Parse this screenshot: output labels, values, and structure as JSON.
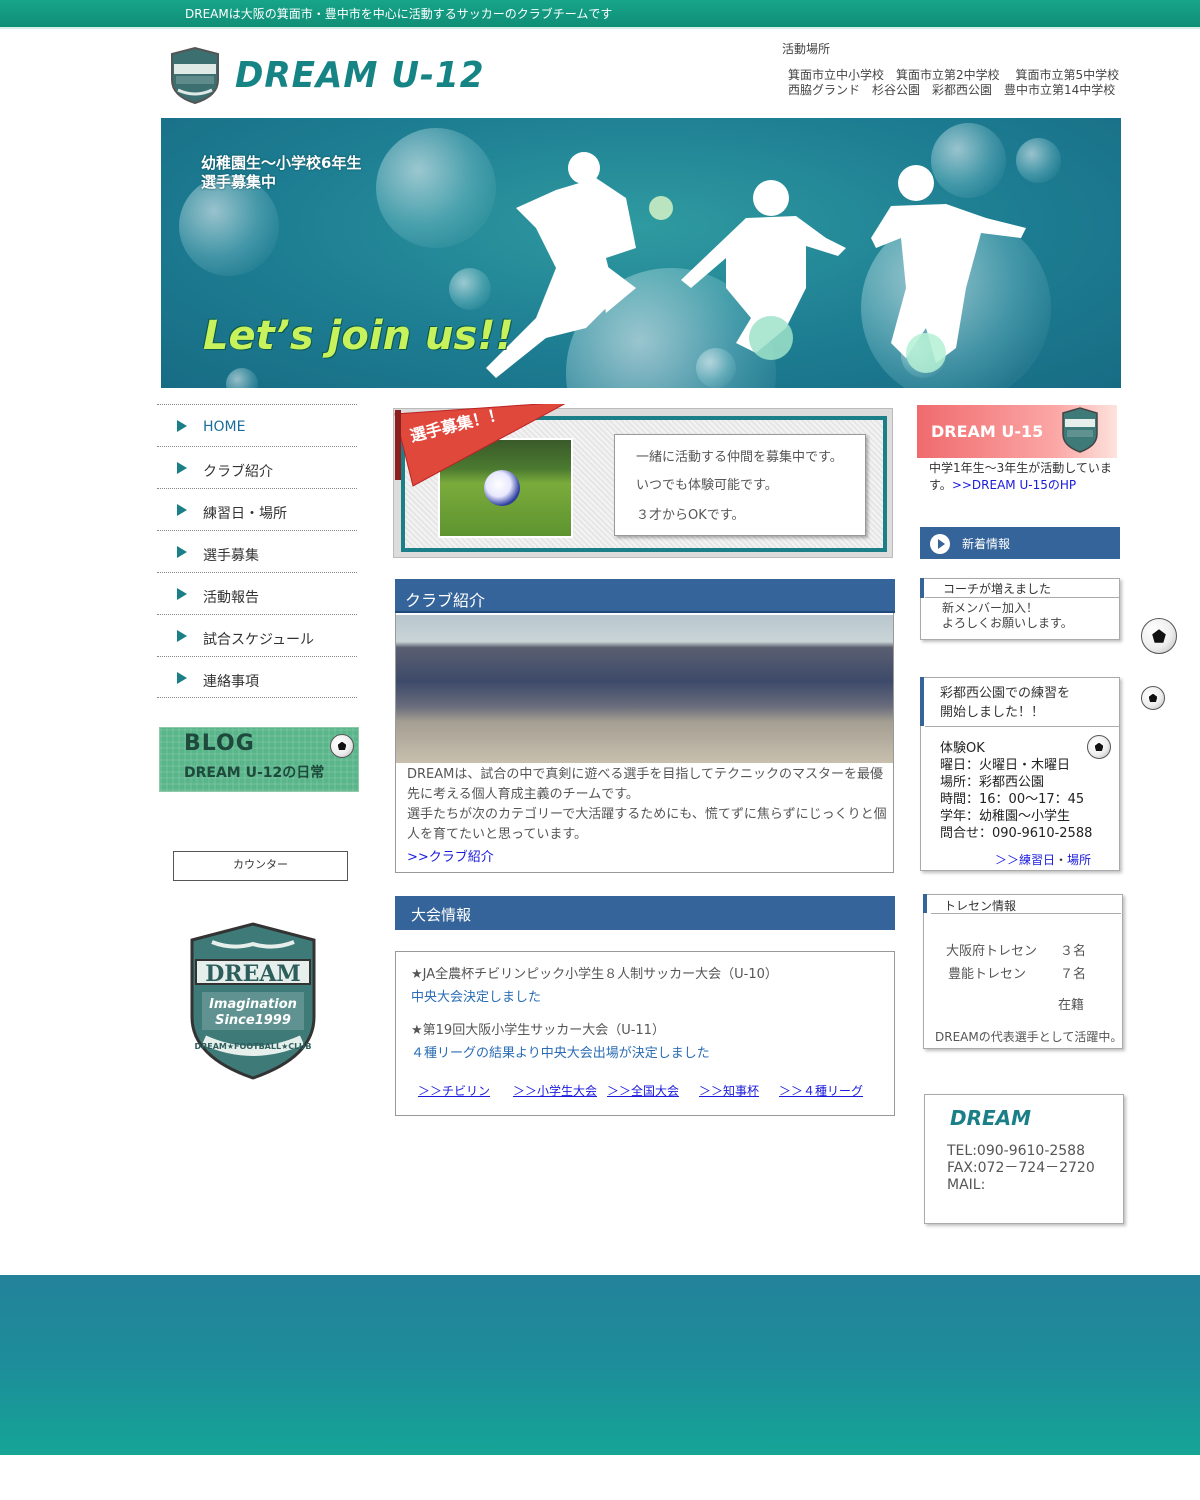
{
  "topbar": {
    "tagline": "DREAMは大阪の箕面市・豊中市を中心に活動するサッカーのクラブチームです"
  },
  "header": {
    "logo_text": "DREAM U-12",
    "locations_title": "活動場所",
    "locations_line1": "箕面市立中小学校　箕面市立第2中学校　 箕面市立第5中学校",
    "locations_line2": "西脇グランド　杉谷公園　彩都西公園　豊中市立第14中学校"
  },
  "hero": {
    "recruit_line1": "幼稚園生～小学校6年生",
    "recruit_line2": "選手募集中",
    "slogan": "Let’s join us!!"
  },
  "nav": {
    "items": [
      {
        "label": "HOME"
      },
      {
        "label": "クラブ紹介"
      },
      {
        "label": "練習日・場所"
      },
      {
        "label": "選手募集"
      },
      {
        "label": "活動報告"
      },
      {
        "label": "試合スケジュール"
      },
      {
        "label": "連絡事項"
      }
    ]
  },
  "blog": {
    "title": "BLOG",
    "subtitle": "DREAM U-12の日常"
  },
  "counter": {
    "label": "カウンター"
  },
  "emblem": {
    "name": "DREAM",
    "motto1": "Imagination",
    "motto2": "Since1999",
    "club": "DREAM★FOOTBALL★CLUB"
  },
  "recruit": {
    "pennant": "選手募集！！",
    "line1": "一緒に活動する仲間を募集中です。",
    "line2": "いつでも体験可能です。",
    "line3": "３才からOKです。"
  },
  "club": {
    "heading": "クラブ紹介",
    "text1": "DREAMは、試合の中で真剣に遊べる選手を目指してテクニックのマスターを最優先に考える個人育成主義のチームです。",
    "text2": "選手たちが次のカテゴリーで大活躍するためにも、慌てずに焦らずにじっくりと個人を育てたいと思っています。",
    "link": ">>クラブ紹介"
  },
  "taikai": {
    "heading": "大会情報",
    "item1_title": "★JA全農杯チビリンピック小学生８人制サッカー大会（U-10）",
    "item1_note": "中央大会決定しました",
    "item2_title": "★第19回大阪小学生サッカー大会（U-11）",
    "item2_note": "４種リーグの結果より中央大会出場が決定しました",
    "links": [
      "＞＞チビリン",
      "＞＞小学生大会",
      "＞＞全国大会",
      "＞＞知事杯",
      "＞＞４種リーグ"
    ]
  },
  "u15": {
    "title": "DREAM U-15",
    "desc": "中学1年生～3年生が活動しています。",
    "link": ">>DREAM U-15のHP"
  },
  "news": {
    "heading": "新着情報"
  },
  "coach": {
    "title": "コーチが増えました",
    "line1": "新メンバー加入！",
    "line2": "よろしくお願いします。"
  },
  "practice": {
    "title_line1": "彩都西公園での練習を",
    "title_line2": "開始しました！！",
    "lines": [
      "体験OK",
      "曜日：火曜日・木曜日",
      "場所：彩都西公園",
      "時間：16：00～17：45",
      "学年：幼稚園～小学生",
      "問合せ：090-9610-2588"
    ],
    "link_a": "＞＞練習日",
    "link_sep": "・",
    "link_b": "場所"
  },
  "tore": {
    "title": "トレセン情報",
    "row1_label": "大阪府トレセン",
    "row1_count": "３名",
    "row2_label": "豊能トレセン",
    "row2_count": "７名",
    "status": "在籍",
    "note": "DREAMの代表選手として活躍中。"
  },
  "contact": {
    "logo": "DREAM",
    "tel": "TEL:090-9610-2588",
    "fax": "FAX:072－724－2720",
    "mail": "MAIL:"
  },
  "colors": {
    "teal": "#1a7f86",
    "navy": "#35649a",
    "pink": "#f06a6e",
    "lime": "#c7f25b"
  }
}
